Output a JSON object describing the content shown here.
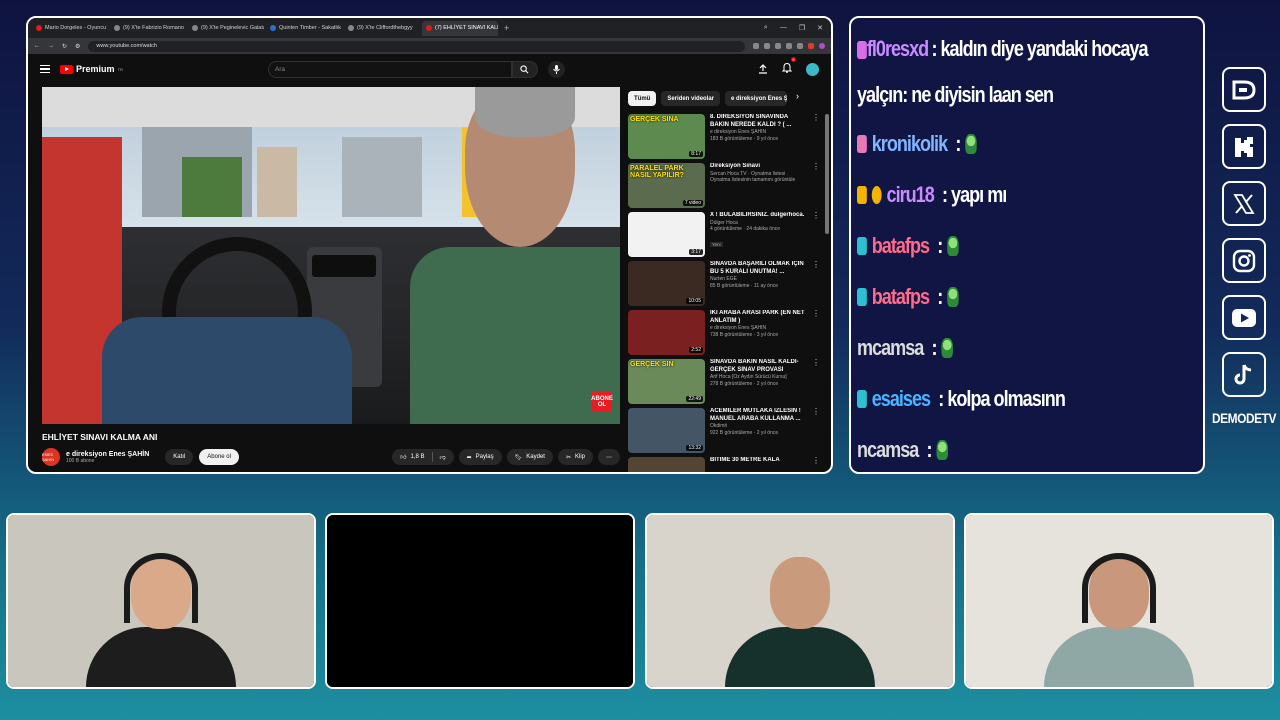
{
  "browser": {
    "tabs": [
      {
        "label": "Mario Dorgeles - Oyuncu",
        "color": "#e21b1b",
        "active": false
      },
      {
        "label": "(9) X'te Fabrizio Romano",
        "color": "#888888",
        "active": false
      },
      {
        "label": "(9) X'te Peginelevic Galata",
        "color": "#888888",
        "active": false
      },
      {
        "label": "Quinten Timber - Sakatlık",
        "color": "#2b6fd6",
        "active": false
      },
      {
        "label": "(9) X'te Cliffordthebgyy",
        "color": "#888888",
        "active": false
      },
      {
        "label": "(7) EHLİYET SINAVI KALM",
        "color": "#e21b1b",
        "active": true
      }
    ],
    "url": "www.youtube.com/watch"
  },
  "youtube": {
    "logo_text": "Premium",
    "logo_region": "TR",
    "search_placeholder": "Ara",
    "notif_count": "9",
    "video_title": "EHLİYET SINAVI KALMA ANI",
    "channel_name": "e direksiyon Enes ŞAHİN",
    "channel_subs": "100 B abone",
    "channel_avatar_text": "ENES ŞAHİN",
    "join_label": "Katıl",
    "subscribe_label": "Abone ol",
    "like_count": "1,8 B",
    "share_label": "Paylaş",
    "save_label": "Kaydet",
    "clip_label": "Klip",
    "overlay_badge": "ABONE OL",
    "chips": [
      "Tümü",
      "Seriden videolar",
      "e direksiyon Enes ŞAHİN"
    ],
    "recommendations": [
      {
        "title": "8. DİREKSİYON SINAVINDA BAKIN NEREDE KALDI ? ( ...",
        "channel": "e direksiyon Enes ŞAHİN",
        "meta": "183 B görüntüleme · 9 yıl önce",
        "duration": "8:17",
        "caption": "GERÇEK SINA",
        "color": "#5d8a4f",
        "badge": ""
      },
      {
        "title": "Direksiyon Sınavı",
        "channel": "Sercan Hoca TV · Oynatma listesi",
        "meta": "Oynatma listesinin tamamını görüntüle",
        "duration": "7 video",
        "caption": "PARALEL PARK NASIL YAPILIR?",
        "color": "#5a6b4e",
        "badge": ""
      },
      {
        "title": "X ! BULABİLİRSİNİZ. dulgerhoca.",
        "channel": "Dülger Hoca",
        "meta": "4 görüntüleme · 24 dakika önce",
        "duration": "3:17",
        "caption": "",
        "color": "#f2f2f2",
        "badge": "Yeni"
      },
      {
        "title": "SINAVDA BAŞARILI OLMAK İÇİN BU 5 KURALI UNUTMA! ...",
        "channel": "Nurten EGE",
        "meta": "85 B görüntüleme · 11 ay önce",
        "duration": "10:05",
        "caption": "",
        "color": "#3a2a22",
        "badge": ""
      },
      {
        "title": "İKİ ARABA ARASI PARK (EN NET ANLATIM )",
        "channel": "e direksiyon Enes ŞAHİN",
        "meta": "738 B görüntüleme · 3 yıl önce",
        "duration": "2:52",
        "caption": "",
        "color": "#7a2020",
        "badge": ""
      },
      {
        "title": "SINAVDA BAKIN NASIL KALDI- GERÇEK SINAV PROVASI",
        "channel": "Arif Hoca [Öz Aydın Sürücü Kursu]",
        "meta": "278 B görüntüleme · 2 yıl önce",
        "duration": "22:49",
        "caption": "GERÇEK SIN",
        "color": "#6a8a5a",
        "badge": ""
      },
      {
        "title": "ACEMİLER MUTLAKA İZLESİN ! MANUEL ARABA KULLANMA ...",
        "channel": "Okdimit",
        "meta": "922 B görüntüleme · 2 yıl önce",
        "duration": "13:32",
        "caption": "",
        "color": "#445566",
        "badge": ""
      },
      {
        "title": "BİTİME 30 METRE KALA",
        "channel": "",
        "meta": "",
        "duration": "",
        "caption": "",
        "color": "#554433",
        "badge": ""
      }
    ]
  },
  "chat": [
    {
      "user": "fl0resxd",
      "user_color": "#c98bff",
      "badge_color": "#d86ee6",
      "text": ": kaldın diye yandaki hocaya yalçın: ne diyisin laan sen",
      "emote": false
    },
    {
      "user": "kronikolik",
      "user_color": "#7fb6ff",
      "badge_color": "#e879b9",
      "text": ":",
      "emote": true
    },
    {
      "user": "ciru18",
      "user_color": "#c98bff",
      "badge_color": "#f2b400",
      "text": ": yapı mı",
      "emote": false
    },
    {
      "user": "batafps",
      "user_color": "#ff6b8b",
      "badge_color": "#2cc0d0",
      "text": ":",
      "emote": true
    },
    {
      "user": "batafps",
      "user_color": "#ff6b8b",
      "badge_color": "#2cc0d0",
      "text": ":",
      "emote": true
    },
    {
      "user": "mcamsa",
      "user_color": "#dcdcdc",
      "badge_color": "",
      "text": ":",
      "emote": true
    },
    {
      "user": "esaises",
      "user_color": "#4ab3ff",
      "badge_color": "#2cc0d0",
      "text": ": kolpa olmasınn",
      "emote": false
    },
    {
      "user": "ncamsa",
      "user_color": "#dcdcdc",
      "badge_color": "",
      "text": ":",
      "emote": true
    }
  ],
  "socials": [
    {
      "name": "dlive-icon",
      "glyph": "D"
    },
    {
      "name": "kick-icon",
      "glyph": "K"
    },
    {
      "name": "x-icon",
      "glyph": "𝕏"
    },
    {
      "name": "instagram-icon",
      "glyph": ""
    },
    {
      "name": "youtube-icon",
      "glyph": ""
    },
    {
      "name": "tiktok-icon",
      "glyph": "♪"
    }
  ],
  "brand_name": "DEMODETV",
  "webcams": [
    {
      "name": "webcam-1",
      "bg": "#c9c6bd",
      "skin": "#d9a98a",
      "shirt": "#1d1d1d",
      "headphones": true
    },
    {
      "name": "webcam-2",
      "bg": "#000000",
      "skin": "",
      "shirt": "",
      "headphones": false
    },
    {
      "name": "webcam-3",
      "bg": "#d8d4cc",
      "skin": "#c99a7c",
      "shirt": "#16302b",
      "headphones": false
    },
    {
      "name": "webcam-4",
      "bg": "#e6e2dc",
      "skin": "#c8977c",
      "shirt": "#8fa8a6",
      "headphones": true
    }
  ]
}
